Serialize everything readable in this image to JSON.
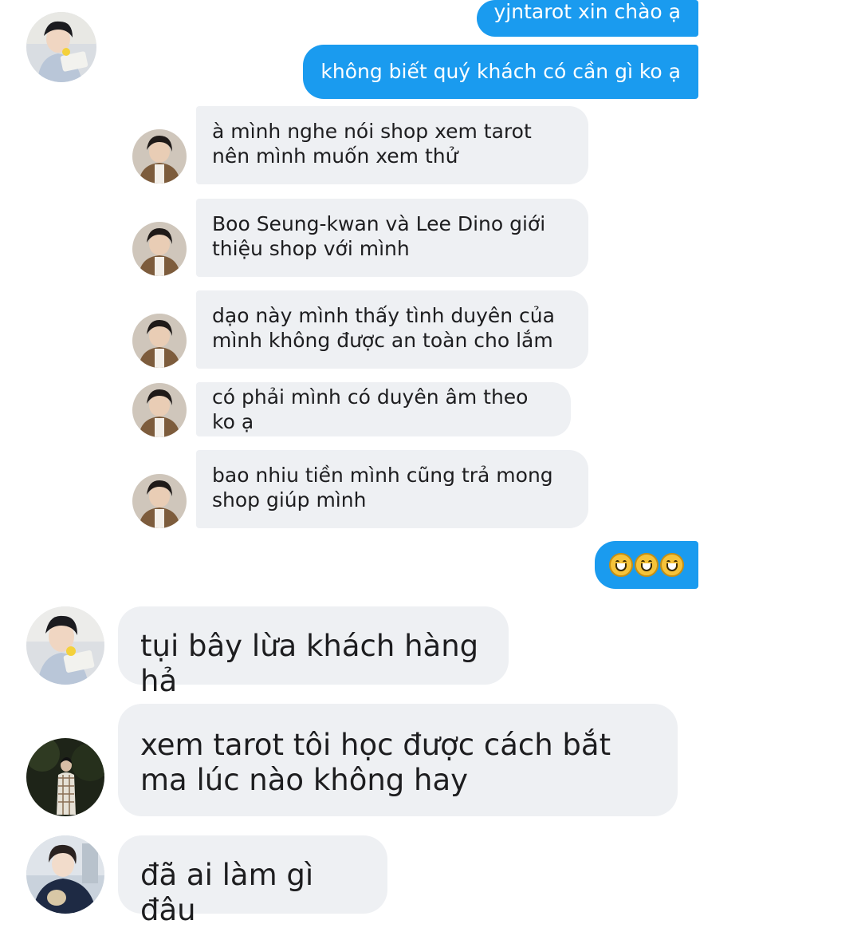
{
  "embedded_chat": {
    "sent_top_partial": "yjntarot xin chào ạ",
    "sent_1": "không biết quý khách có cần gì ko ạ",
    "incoming": [
      "à mình nghe nói shop xem tarot nên mình muốn xem thử",
      "Boo Seung-kwan và Lee Dino giới thiệu shop với mình",
      "dạo này mình thấy tình duyên của mình không được an toàn cho lắm",
      "có phải mình có duyên âm theo ko ạ",
      "bao nhiu tiền mình cũng trả mong shop giúp mình"
    ],
    "sent_emoji": "😅😅😅"
  },
  "chat": {
    "messages": [
      {
        "text": "tụi bây lừa khách hàng hả"
      },
      {
        "text": "xem tarot tôi học được cách bắt ma lúc nào không hay"
      },
      {
        "text": "đã ai làm gì đâu"
      }
    ]
  },
  "icons": {
    "avatar_1": "person-reading-avatar-icon",
    "avatar_2": "person-dark-avatar-icon",
    "avatar_3": "person-hoodie-avatar-icon",
    "customer_avatar": "customer-avatar-icon"
  },
  "colors": {
    "sent_bubble": "#1a9bef",
    "incoming_bubble": "#eef0f3",
    "text": "#1d1d1f"
  }
}
